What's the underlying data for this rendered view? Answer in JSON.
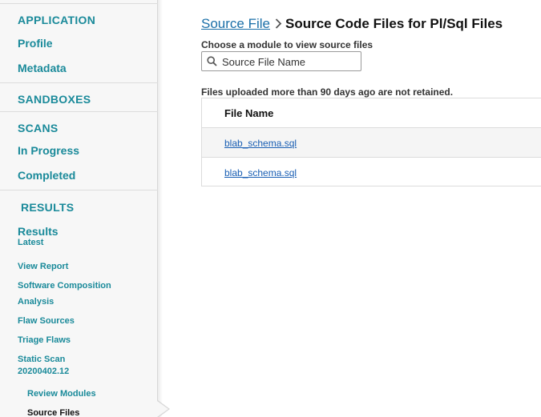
{
  "sidebar": {
    "application": {
      "header": "APPLICATION",
      "items": [
        "Profile",
        "Metadata"
      ]
    },
    "sandboxes": {
      "header": "SANDBOXES"
    },
    "scans": {
      "header": "SCANS",
      "items": [
        "In Progress",
        "Completed"
      ]
    },
    "results": {
      "header": "RESULTS",
      "results_link": "Results",
      "results_sub": "Latest",
      "items": [
        "View Report",
        "Software Composition",
        "Analysis",
        "Flaw Sources",
        "Triage Flaws"
      ],
      "static_scan_line1": "Static Scan",
      "static_scan_line2": "20200402.12",
      "sub_items": [
        "Review Modules",
        "Source Files"
      ]
    }
  },
  "breadcrumb": {
    "parent": "Source File",
    "current": "Source Code Files for Pl/Sql Files"
  },
  "choose_label": "Choose a module to view source files",
  "search": {
    "placeholder": "Source File Name",
    "value": ""
  },
  "retain_note": "Files uploaded more than 90 days ago are not retained.",
  "table": {
    "column_header": "File Name",
    "rows": [
      "blab_schema.sql",
      "blab_schema.sql"
    ]
  },
  "colors": {
    "accent": "#1a8a9a",
    "link": "#1a5fb4"
  }
}
